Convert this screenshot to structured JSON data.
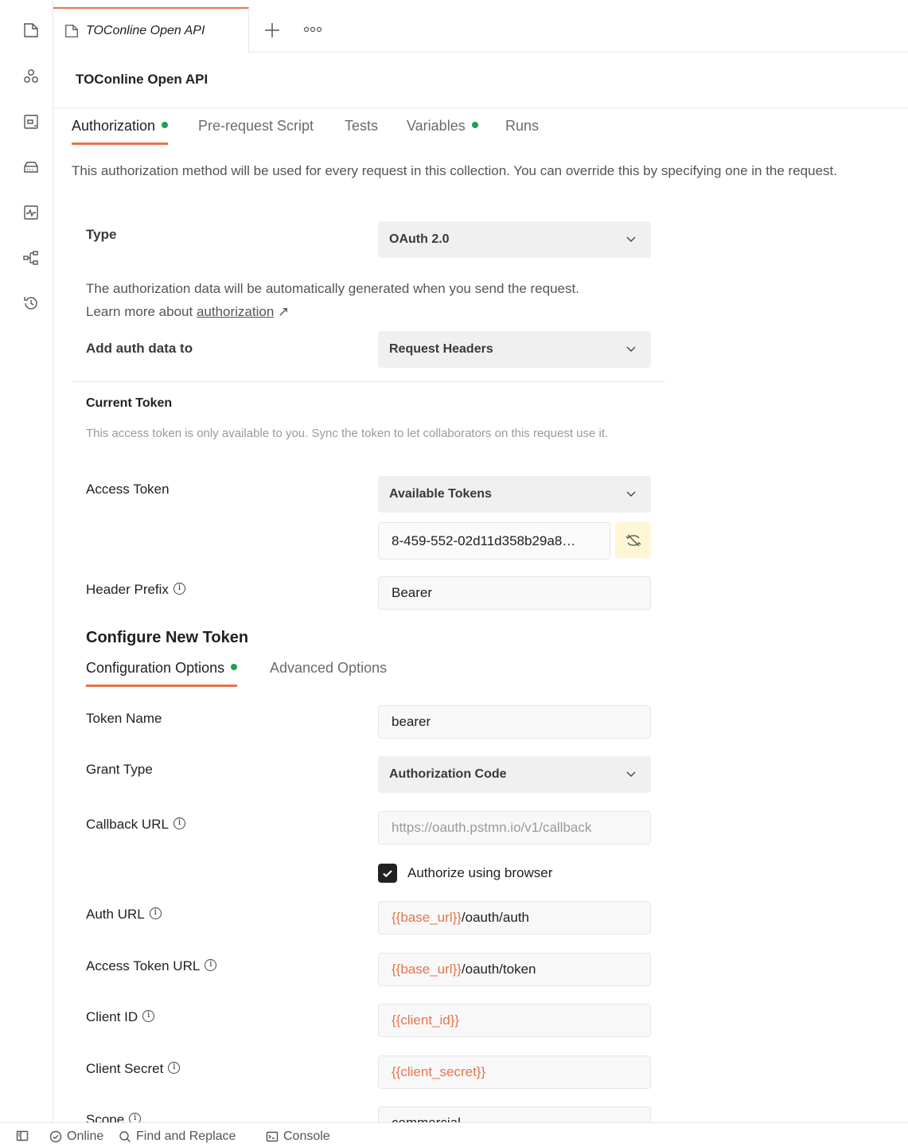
{
  "tab": {
    "label": "TOConline Open API"
  },
  "collection": {
    "title": "TOConline Open API"
  },
  "subtabs": [
    {
      "label": "Authorization",
      "has_dot": true,
      "active": true
    },
    {
      "label": "Pre-request Script",
      "has_dot": false,
      "active": false
    },
    {
      "label": "Tests",
      "has_dot": false,
      "active": false
    },
    {
      "label": "Variables",
      "has_dot": true,
      "active": false
    },
    {
      "label": "Runs",
      "has_dot": false,
      "active": false
    }
  ],
  "info_line": "This authorization method will be used for every request in this collection. You can override this by specifying one in the request.",
  "auth": {
    "type_label": "Type",
    "type_value": "OAuth 2.0",
    "desc_text": "The authorization data will be automatically generated when you send the request. Learn more about",
    "desc_link": "authorization",
    "desc_arrow": "↗",
    "add_to_label": "Add auth data to",
    "add_to_value": "Request Headers"
  },
  "current_token": {
    "title": "Current Token",
    "desc": "This access token is only available to you. Sync the token to let collaborators on this request use it.",
    "access_token_label": "Access Token",
    "access_token_dropdown": "Available Tokens",
    "token_value": "8-459-552-02d11d358b29a8…",
    "header_prefix_label": "Header Prefix",
    "header_prefix_value": "Bearer"
  },
  "configure": {
    "title": "Configure New Token",
    "tabs": [
      {
        "label": "Configuration Options",
        "has_dot": true,
        "active": true
      },
      {
        "label": "Advanced Options",
        "has_dot": false,
        "active": false
      }
    ],
    "token_name_label": "Token Name",
    "token_name_value": "bearer",
    "grant_type_label": "Grant Type",
    "grant_type_value": "Authorization Code",
    "callback_label": "Callback URL",
    "callback_value": "https://oauth.pstmn.io/v1/callback",
    "authorize_browser_label": "Authorize using browser",
    "auth_url_label": "Auth URL",
    "auth_url_var": "{{base_url}}",
    "auth_url_path": "/oauth/auth",
    "access_token_url_label": "Access Token URL",
    "access_token_url_var": "{{base_url}}",
    "access_token_url_path": "/oauth/token",
    "client_id_label": "Client ID",
    "client_id_value": "{{client_id}}",
    "client_secret_label": "Client Secret",
    "client_secret_value": "{{client_secret}}",
    "scope_label": "Scope",
    "scope_value": "commercial"
  },
  "statusbar": {
    "online": "Online",
    "find_replace": "Find and Replace",
    "console": "Console"
  },
  "colors": {
    "accent": "#e8734a",
    "dot": "#1fa14d",
    "variable": "#e8734a"
  },
  "icons": [
    "collections-icon",
    "apis-icon",
    "environments-icon",
    "mock-servers-icon",
    "monitors-icon",
    "flows-icon",
    "history-icon"
  ]
}
